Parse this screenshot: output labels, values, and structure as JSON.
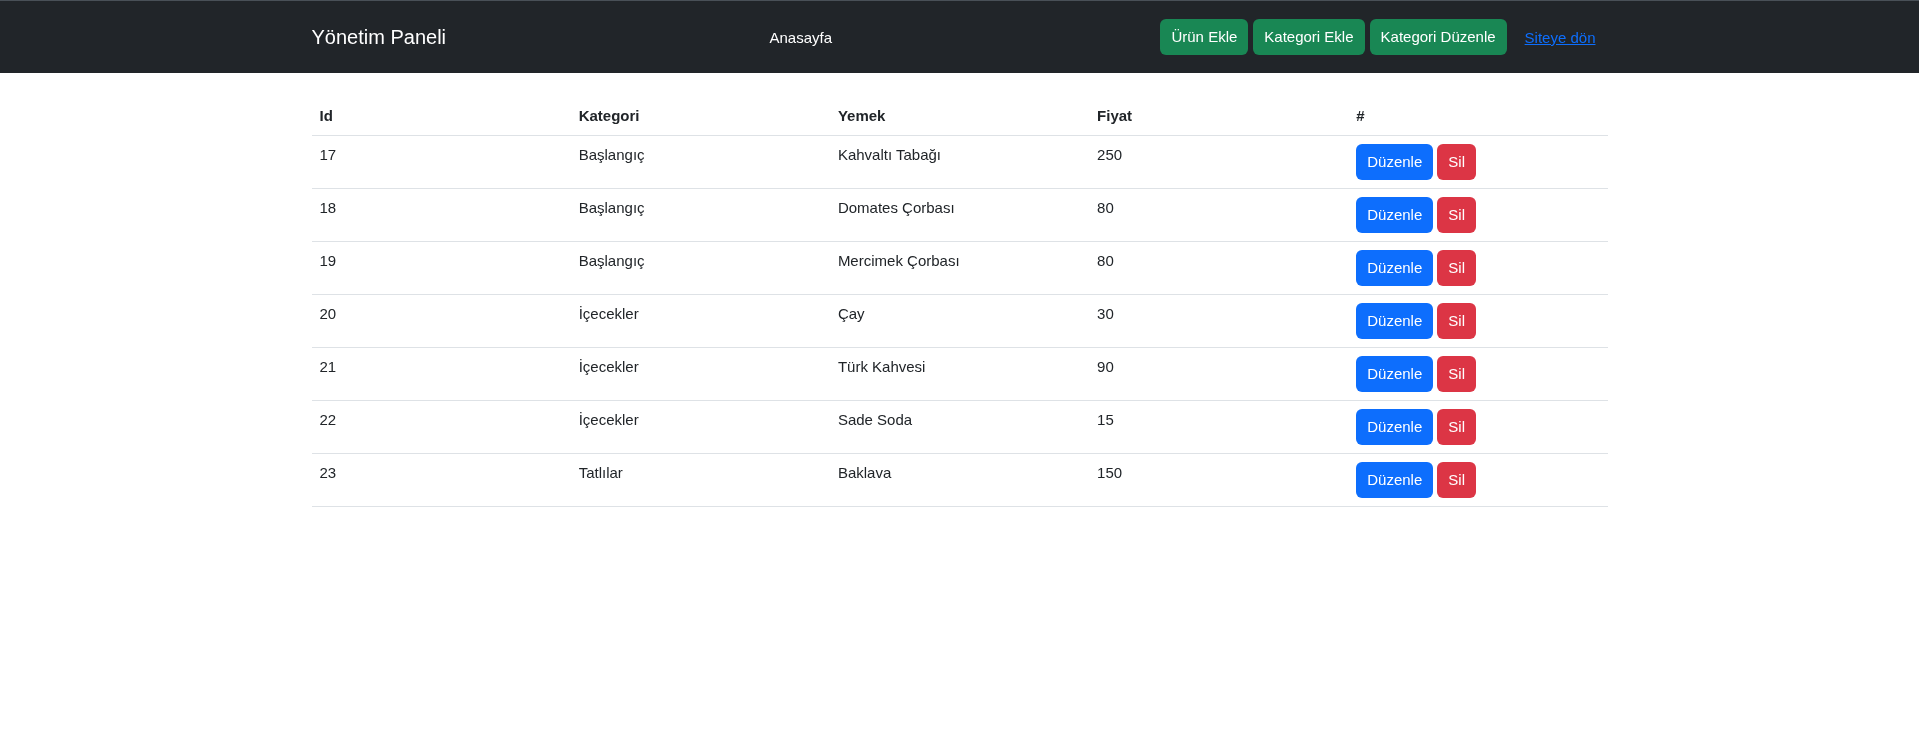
{
  "navbar": {
    "brand": "Yönetim Paneli",
    "nav_link": "Anasayfa",
    "buttons": [
      "Ürün Ekle",
      "Kategori Ekle",
      "Kategori Düzenle"
    ],
    "link": "Siteye dön"
  },
  "table": {
    "columns": [
      "Id",
      "Kategori",
      "Yemek",
      "Fiyat",
      "#"
    ],
    "rows": [
      {
        "cells": [
          "17",
          "Başlangıç",
          "Kahvaltı Tabağı",
          "250"
        ],
        "actions": [
          {
            "label": "Düzenle",
            "kind": "edit"
          },
          {
            "label": "Sil",
            "kind": "delete"
          }
        ]
      },
      {
        "cells": [
          "18",
          "Başlangıç",
          "Domates Çorbası",
          "80"
        ],
        "actions": [
          {
            "label": "Düzenle",
            "kind": "edit"
          },
          {
            "label": "Sil",
            "kind": "delete"
          }
        ]
      },
      {
        "cells": [
          "19",
          "Başlangıç",
          "Mercimek Çorbası",
          "80"
        ],
        "actions": [
          {
            "label": "Düzenle",
            "kind": "edit"
          },
          {
            "label": "Sil",
            "kind": "delete"
          }
        ]
      },
      {
        "cells": [
          "20",
          "İçecekler",
          "Çay",
          "30"
        ],
        "actions": [
          {
            "label": "Düzenle",
            "kind": "edit"
          },
          {
            "label": "Sil",
            "kind": "delete"
          }
        ]
      },
      {
        "cells": [
          "21",
          "İçecekler",
          "Türk Kahvesi",
          "90"
        ],
        "actions": [
          {
            "label": "Düzenle",
            "kind": "edit"
          },
          {
            "label": "Sil",
            "kind": "delete"
          }
        ]
      },
      {
        "cells": [
          "22",
          "İçecekler",
          "Sade Soda",
          "15"
        ],
        "actions": [
          {
            "label": "Düzenle",
            "kind": "edit"
          },
          {
            "label": "Sil",
            "kind": "delete"
          }
        ]
      },
      {
        "cells": [
          "23",
          "Tatlılar",
          "Baklava",
          "150"
        ],
        "actions": [
          {
            "label": "Düzenle",
            "kind": "edit"
          },
          {
            "label": "Sil",
            "kind": "delete"
          }
        ]
      }
    ]
  }
}
